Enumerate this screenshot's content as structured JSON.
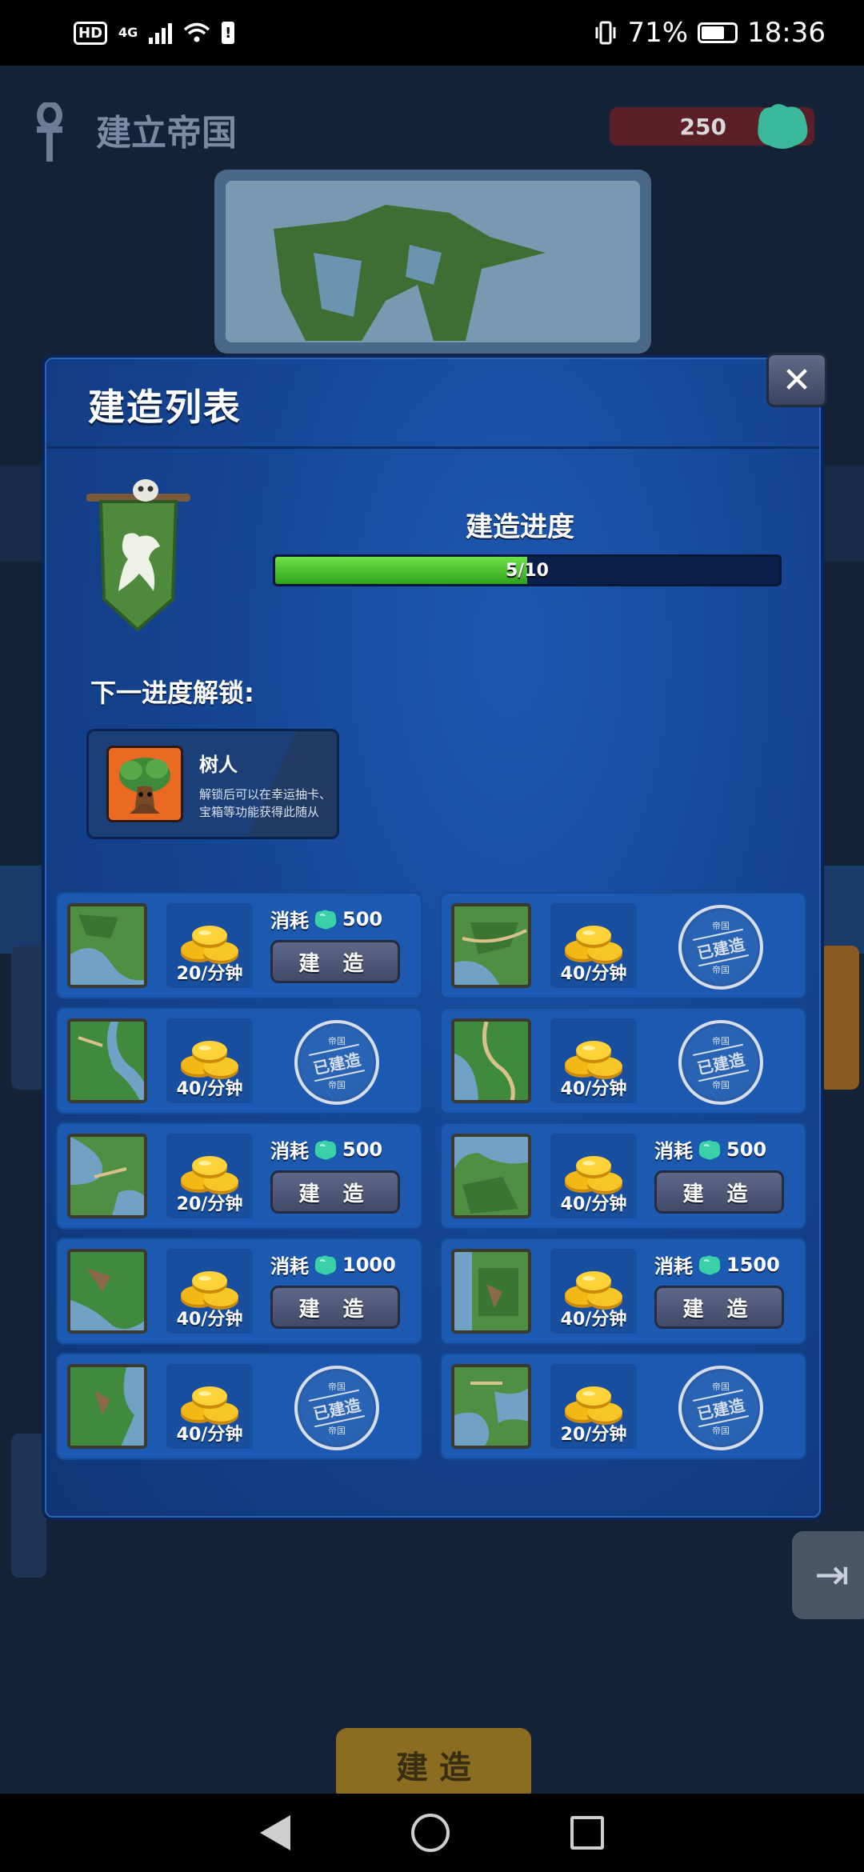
{
  "status_bar": {
    "network": "4G",
    "hd": "HD",
    "battery": "71%",
    "time": "18:36"
  },
  "background": {
    "title": "建立帝国",
    "gems": "250",
    "build_button": "建 造"
  },
  "modal": {
    "title": "建造列表",
    "close_icon": "close-icon",
    "progress": {
      "label": "建造进度",
      "text": "5/10",
      "current": 5,
      "total": 10
    },
    "next_unlock": {
      "label": "下一进度解锁:",
      "name": "树人",
      "description": "解锁后可以在幸运抽卡、宝箱等功能获得此随从"
    }
  },
  "items": [
    {
      "rate": "20/分钟",
      "built": false,
      "cost_label": "消耗",
      "cost": "500",
      "button": "建 造"
    },
    {
      "rate": "40/分钟",
      "built": true,
      "stamp_top": "帝国",
      "stamp": "已建造",
      "stamp_bottom": "帝国"
    },
    {
      "rate": "40/分钟",
      "built": true,
      "stamp_top": "帝国",
      "stamp": "已建造",
      "stamp_bottom": "帝国"
    },
    {
      "rate": "40/分钟",
      "built": true,
      "stamp_top": "帝国",
      "stamp": "已建造",
      "stamp_bottom": "帝国"
    },
    {
      "rate": "20/分钟",
      "built": false,
      "cost_label": "消耗",
      "cost": "500",
      "button": "建 造"
    },
    {
      "rate": "40/分钟",
      "built": false,
      "cost_label": "消耗",
      "cost": "500",
      "button": "建 造"
    },
    {
      "rate": "40/分钟",
      "built": false,
      "cost_label": "消耗",
      "cost": "1000",
      "button": "建 造"
    },
    {
      "rate": "40/分钟",
      "built": false,
      "cost_label": "消耗",
      "cost": "1500",
      "button": "建 造"
    },
    {
      "rate": "40/分钟",
      "built": true,
      "stamp_top": "帝国",
      "stamp": "已建造",
      "stamp_bottom": "帝国"
    },
    {
      "rate": "20/分钟",
      "built": true,
      "stamp_top": "帝国",
      "stamp": "已建造",
      "stamp_bottom": "帝国"
    }
  ],
  "colors": {
    "modal_blue": "#154593",
    "progress_green": "#4fc230",
    "gem_teal": "#3ad1a6",
    "coin_gold": "#f2b814"
  }
}
